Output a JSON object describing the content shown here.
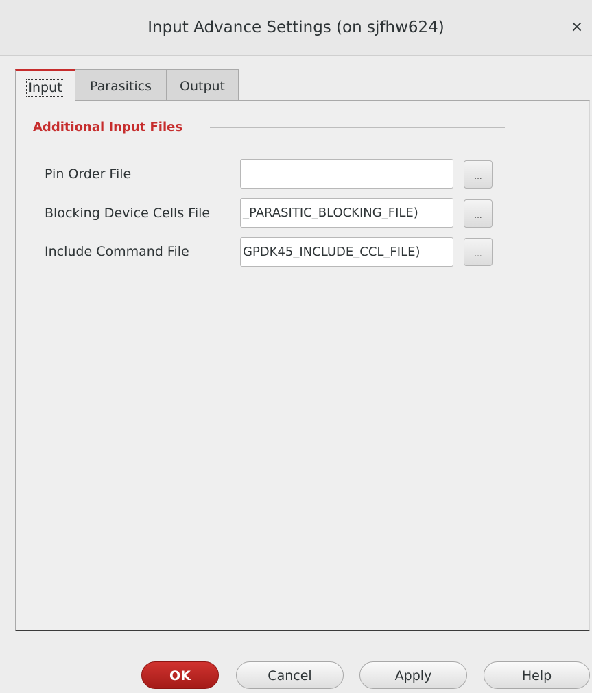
{
  "window": {
    "title": "Input Advance Settings (on sjfhw624)",
    "close_icon": "×"
  },
  "tabs": [
    {
      "label": "Input",
      "active": true
    },
    {
      "label": "Parasitics",
      "active": false
    },
    {
      "label": "Output",
      "active": false
    }
  ],
  "section": {
    "title": "Additional Input Files"
  },
  "rows": [
    {
      "label": "Pin Order File",
      "value": "",
      "browse_label": "..."
    },
    {
      "label": "Blocking Device Cells File",
      "value": "_PARASITIC_BLOCKING_FILE)",
      "browse_label": "..."
    },
    {
      "label": "Include Command File",
      "value": "GPDK45_INCLUDE_CCL_FILE)",
      "browse_label": "..."
    }
  ],
  "buttons": {
    "ok": {
      "mnemonic": "O",
      "rest": "K"
    },
    "cancel": {
      "mnemonic": "C",
      "rest": "ancel"
    },
    "apply": {
      "mnemonic": "A",
      "rest": "pply"
    },
    "help": {
      "mnemonic": "H",
      "rest": "elp"
    }
  },
  "colors": {
    "accent": "#c62d2d",
    "ok_button": "#b8221f"
  }
}
